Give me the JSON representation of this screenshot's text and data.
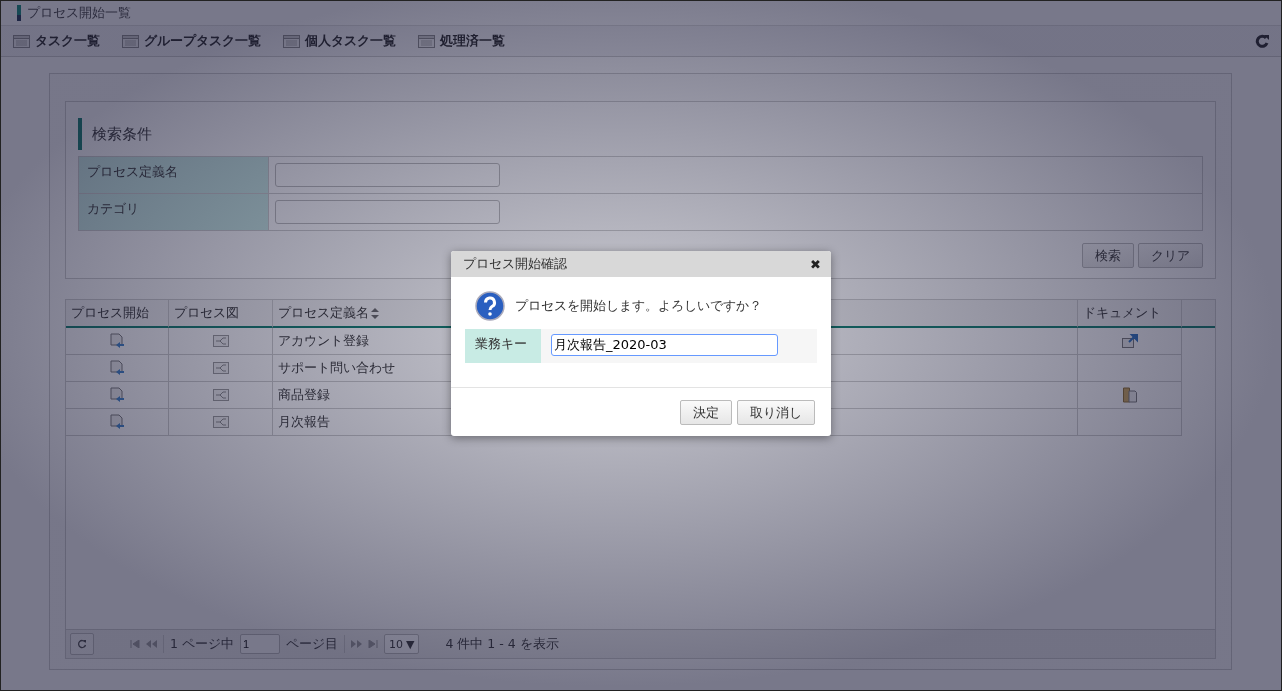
{
  "window": {
    "title": "プロセス開始一覧"
  },
  "toolbar": {
    "items": [
      {
        "label": "タスク一覧"
      },
      {
        "label": "グループタスク一覧"
      },
      {
        "label": "個人タスク一覧"
      },
      {
        "label": "処理済一覧"
      }
    ]
  },
  "search": {
    "title": "検索条件",
    "fields": [
      {
        "label": "プロセス定義名"
      },
      {
        "label": "カテゴリ"
      }
    ],
    "buttons": [
      "検索",
      "クリア"
    ]
  },
  "table": {
    "columns": [
      "プロセス開始",
      "プロセス図",
      "プロセス定義名",
      "ドキュメント"
    ],
    "rows": [
      {
        "name": "アカウント登録",
        "kind": "link"
      },
      {
        "name": "サポート問い合わせ",
        "kind": "plain"
      },
      {
        "name": "商品登録",
        "kind": "files"
      },
      {
        "name": "月次報告",
        "kind": "plain"
      }
    ]
  },
  "pager": {
    "total_pages_label": "1 ページ中",
    "page": "1",
    "page_suffix": "ページ目",
    "page_size": "10",
    "page_size_caret": "▼",
    "summary": "4 件中 1 - 4 を表示"
  },
  "dialog": {
    "title": "プロセス開始確認",
    "close": "✖",
    "message": "プロセスを開始します。よろしいですか？",
    "field_label": "業務キー",
    "field_value": "月次報告_2020-03",
    "buttons": [
      "決定",
      "取り消し"
    ]
  }
}
